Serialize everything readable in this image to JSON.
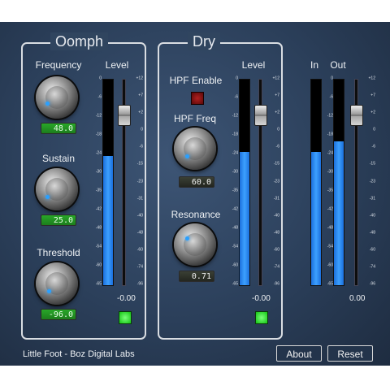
{
  "panels": {
    "oomph": {
      "title": "Oomph",
      "frequency": {
        "label": "Frequency",
        "value": "48.0"
      },
      "sustain": {
        "label": "Sustain",
        "value": "25.0"
      },
      "threshold": {
        "label": "Threshold",
        "value": "-96.0"
      },
      "level": {
        "label": "Level",
        "value": "-0.00",
        "meter_fill": 0.63
      }
    },
    "dry": {
      "title": "Dry",
      "hpf_enable_label": "HPF Enable",
      "hpf_freq": {
        "label": "HPF Freq",
        "value": "60.0"
      },
      "resonance": {
        "label": "Resonance",
        "value": "0.71"
      },
      "level": {
        "label": "Level",
        "value": "-0.00",
        "meter_fill": 0.65
      }
    },
    "io": {
      "in_label": "In",
      "out_label": "Out",
      "out_value": "0.00",
      "in_fill": 0.65,
      "out_fill": 0.7
    }
  },
  "meter_scale": [
    "0",
    "-6",
    "-12",
    "-18",
    "-24",
    "-30",
    "-35",
    "-42",
    "-48",
    "-54",
    "-60",
    "-65"
  ],
  "fader_scale": [
    "+12",
    "+7",
    "+2",
    "0",
    "-6",
    "-15",
    "-23",
    "-31",
    "-40",
    "-48",
    "-60",
    "-74",
    "-96"
  ],
  "footer": {
    "brand": "Little Foot - Boz Digital Labs",
    "about_label": "About",
    "reset_label": "Reset"
  },
  "colors": {
    "accent": "#2f8ff0",
    "led_on": "#33e033",
    "background": "#2f4460"
  }
}
